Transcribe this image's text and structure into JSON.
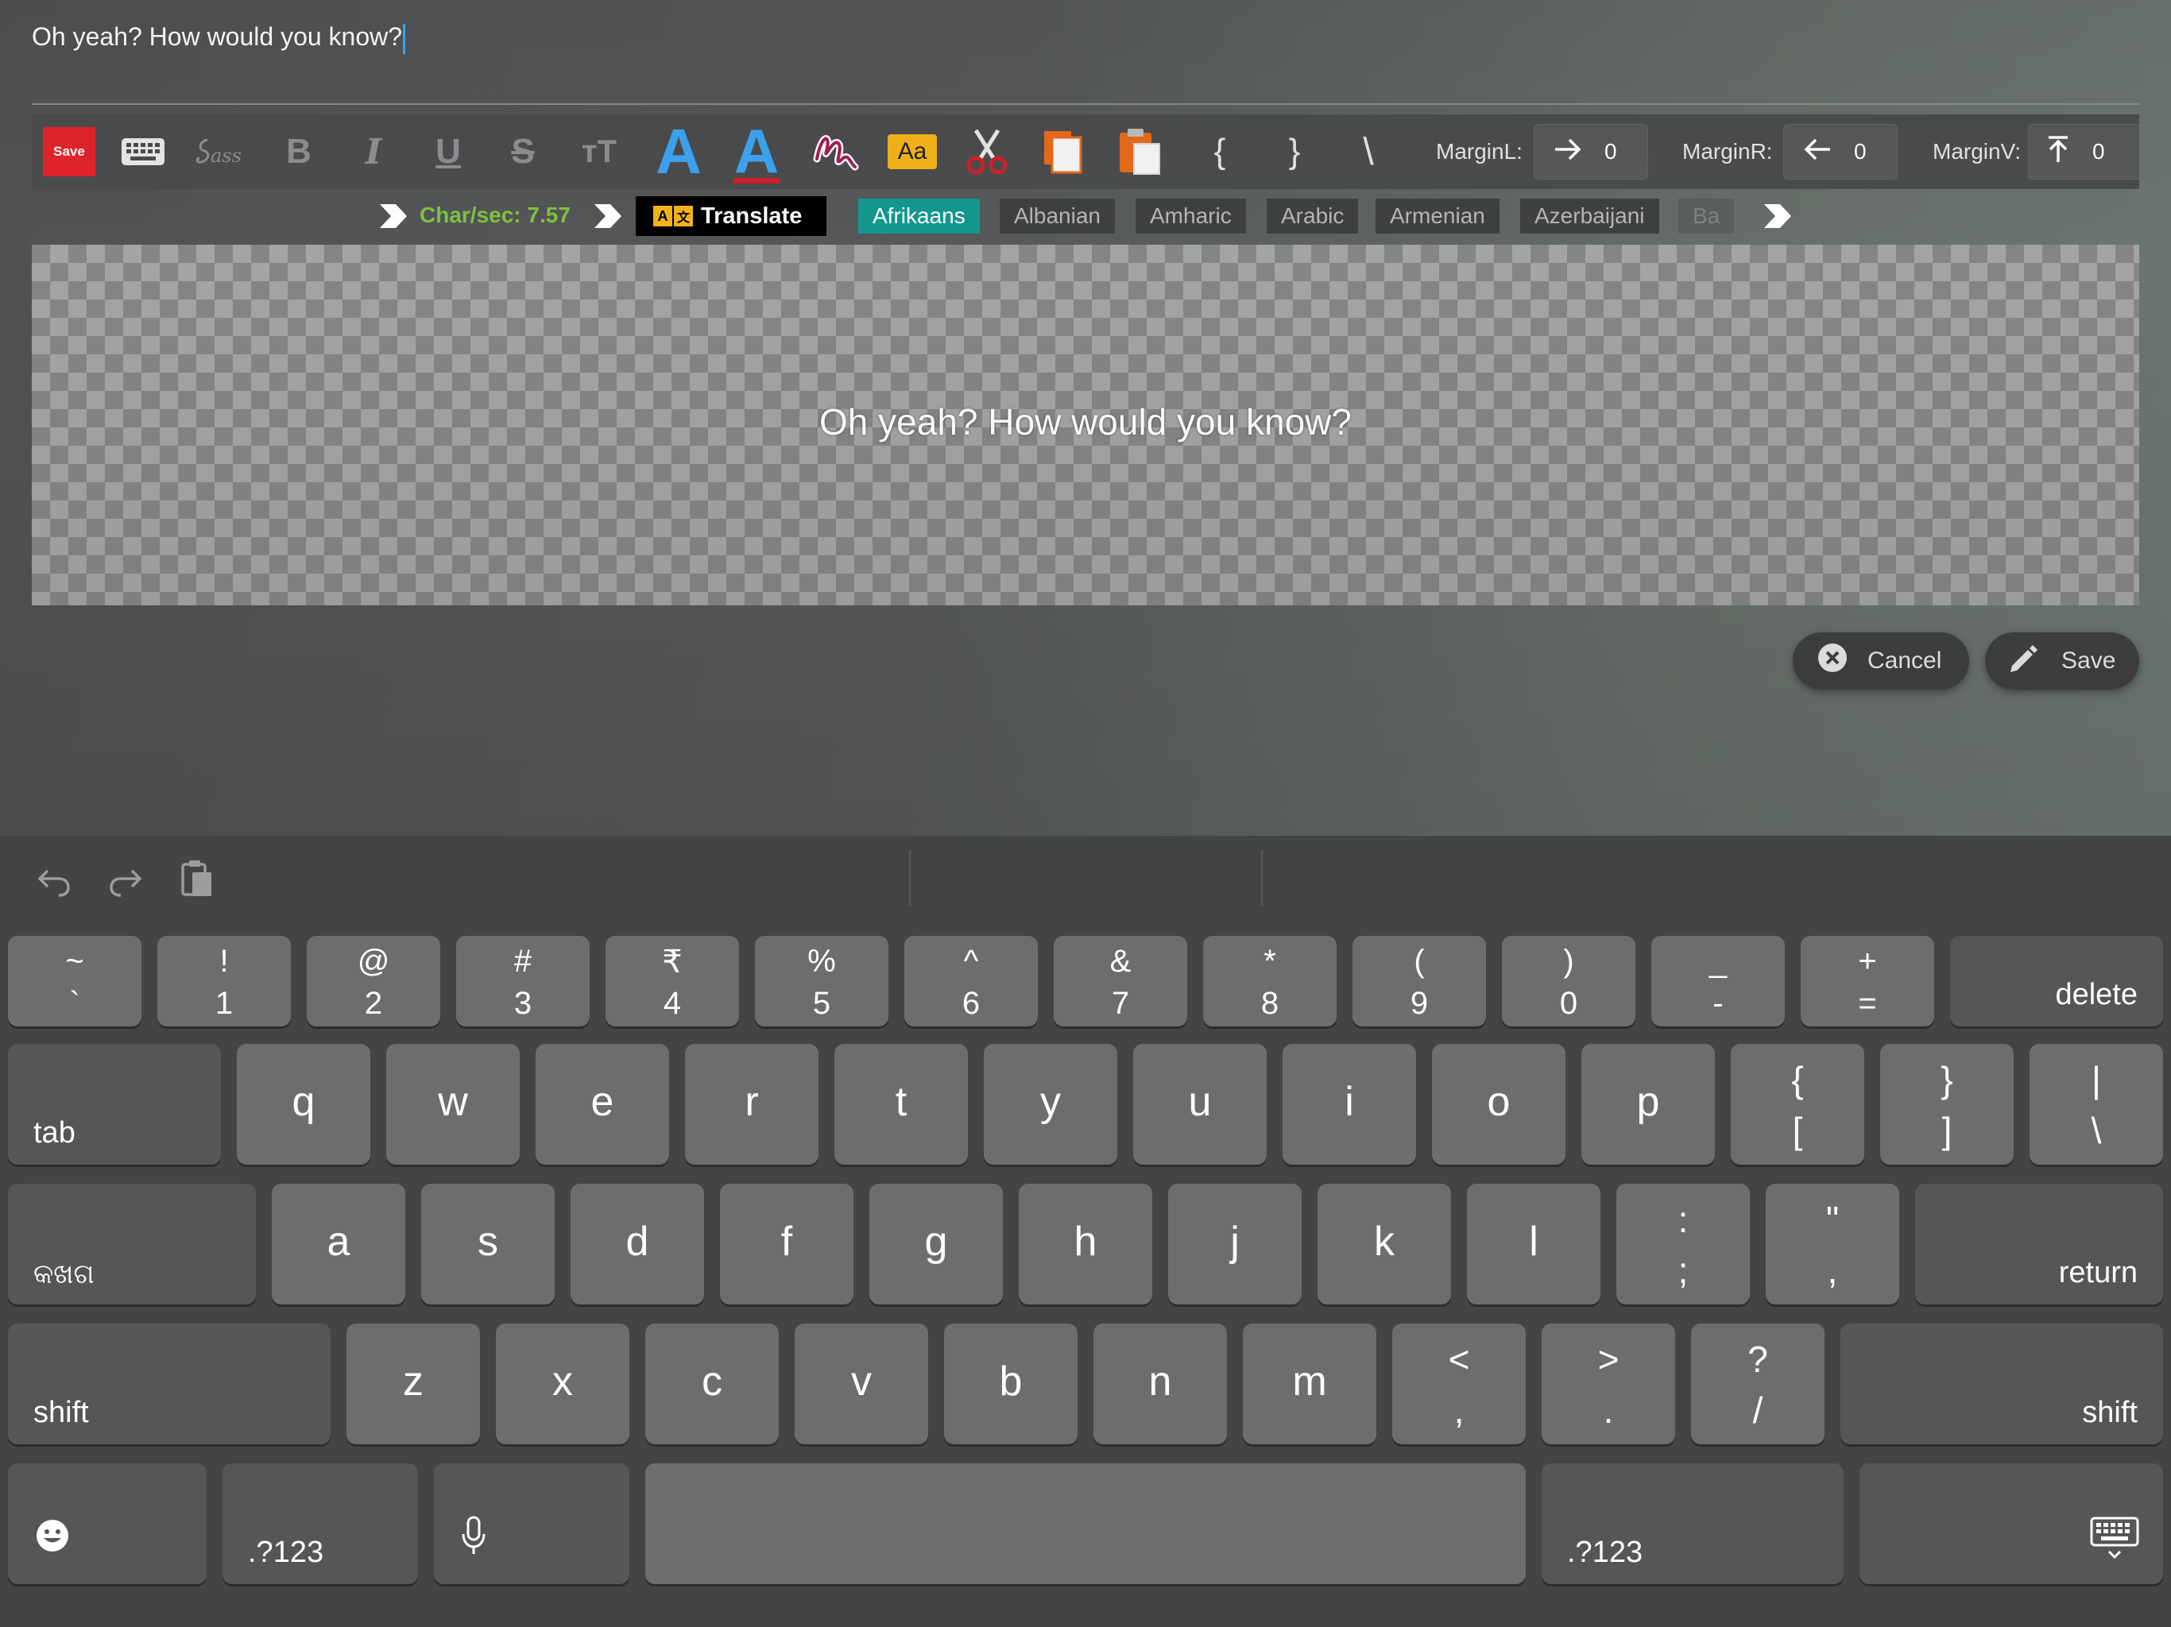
{
  "editor": {
    "text": "Oh yeah? How would you know?"
  },
  "toolbar": {
    "save_label": "Save",
    "bold": "B",
    "italic": "I",
    "underline": "U",
    "strike": "S",
    "fontsize": "ᴛT",
    "font_letter": "A",
    "font_color_letter": "A",
    "case_label": "Aa",
    "brace_open": "{",
    "brace_close": "}",
    "backslash": "\\",
    "margin_l_label": "MarginL:",
    "margin_l_value": "0",
    "margin_r_label": "MarginR:",
    "margin_r_value": "0",
    "margin_v_label": "MarginV:",
    "margin_v_value": "0"
  },
  "status": {
    "charsec": "Char/sec: 7.57",
    "translate_label": "Translate",
    "translate_icon_a": "A",
    "translate_icon_b": "文",
    "languages": [
      "Afrikaans",
      "Albanian",
      "Amharic",
      "Arabic",
      "Armenian",
      "Azerbaijani",
      "Ba"
    ],
    "active_language": "Afrikaans"
  },
  "preview": {
    "text": "Oh yeah? How would you know?"
  },
  "actions": {
    "cancel_label": "Cancel",
    "save_label": "Save"
  },
  "keyboard": {
    "row1": [
      {
        "top": "~",
        "bot": "`"
      },
      {
        "top": "!",
        "bot": "1"
      },
      {
        "top": "@",
        "bot": "2"
      },
      {
        "top": "#",
        "bot": "3"
      },
      {
        "top": "₹",
        "bot": "4"
      },
      {
        "top": "%",
        "bot": "5"
      },
      {
        "top": "^",
        "bot": "6"
      },
      {
        "top": "&",
        "bot": "7"
      },
      {
        "top": "*",
        "bot": "8"
      },
      {
        "top": "(",
        "bot": "9"
      },
      {
        "top": ")",
        "bot": "0"
      },
      {
        "top": "_",
        "bot": "-"
      },
      {
        "top": "+",
        "bot": "="
      }
    ],
    "delete": "delete",
    "tab": "tab",
    "row2": [
      "q",
      "w",
      "e",
      "r",
      "t",
      "y",
      "u",
      "i",
      "o",
      "p"
    ],
    "row2_sym": [
      {
        "top": "{",
        "bot": "["
      },
      {
        "top": "}",
        "bot": "]"
      },
      {
        "top": "|",
        "bot": "\\"
      }
    ],
    "lang_switch": "କଖଗ",
    "row3": [
      "a",
      "s",
      "d",
      "f",
      "g",
      "h",
      "j",
      "k",
      "l"
    ],
    "row3_sym": [
      {
        "top": ":",
        "bot": ";"
      },
      {
        "top": "\"",
        "bot": ","
      }
    ],
    "return": "return",
    "shift": "shift",
    "row4": [
      "z",
      "x",
      "c",
      "v",
      "b",
      "n",
      "m"
    ],
    "row4_sym": [
      {
        "top": "<",
        "bot": ","
      },
      {
        "top": ">",
        "bot": "."
      },
      {
        "top": "?",
        "bot": "/"
      }
    ],
    "numbers": ".?123"
  }
}
